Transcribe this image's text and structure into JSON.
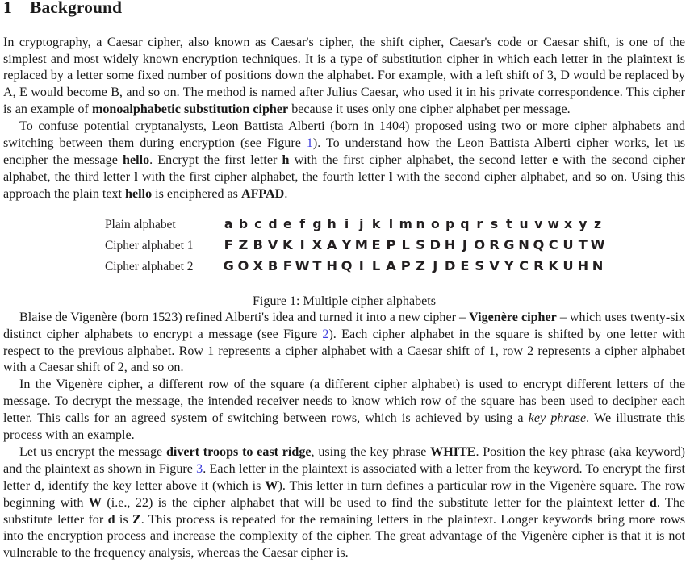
{
  "heading": {
    "number": "1",
    "title": "Background"
  },
  "paragraphs": {
    "p1_a": "In cryptography, a Caesar cipher, also known as Caesar's cipher, the shift cipher, Caesar's code or Caesar shift, is one of the simplest and most widely known encryption techniques. It is a type of substitution cipher in which each letter in the plaintext is replaced by a letter some fixed number of positions down the alphabet. For example, with a left shift of 3, D would be replaced by A, E would become B, and so on. The method is named after Julius Caesar, who used it in his private correspondence. This cipher is an example of ",
    "p1_bold": "monoalphabetic substitution cipher",
    "p1_b": " because it uses only one cipher alphabet per message.",
    "p2_a": "To confuse potential cryptanalysts, Leon Battista Alberti (born in 1404) proposed using two or more cipher alphabets and switching between them during encryption (see Figure ",
    "p2_ref1": "1",
    "p2_b": "). To understand how the Leon Battista Alberti cipher works, let us encipher the message ",
    "p2_bold1": "hello",
    "p2_c": ". Encrypt the first letter ",
    "p2_bold2": "h",
    "p2_d": " with the first cipher alphabet, the second letter ",
    "p2_bold3": "e",
    "p2_e": " with the second cipher alphabet, the third letter ",
    "p2_bold4": "l",
    "p2_f": " with the first cipher alphabet, the fourth letter ",
    "p2_bold5": "l",
    "p2_g": " with the second cipher alphabet, and so on. Using this approach the plain text ",
    "p2_bold6": "hello",
    "p2_h": " is enciphered as ",
    "p2_bold7": "AFPAD",
    "p2_i": ".",
    "p3_a": "Blaise de Vigenère (born 1523) refined Alberti's idea and turned it into a new cipher – ",
    "p3_bold1": "Vigenère cipher",
    "p3_b": " – which uses twenty-six distinct cipher alphabets to encrypt a message (see Figure ",
    "p3_ref2": "2",
    "p3_c": "). Each cipher alphabet in the square is shifted by one letter with respect to the previous alphabet. Row 1 represents a cipher alphabet with a Caesar shift of 1, row 2 represents a cipher alphabet with a Caesar shift of 2, and so on.",
    "p4_a": "In the Vigenère cipher, a different row of the square (a different cipher alphabet) is used to encrypt different letters of the message. To decrypt the message, the intended receiver needs to know which row of the square has been used to decipher each letter. This calls for an agreed system of switching between rows, which is achieved by using a ",
    "p4_italic": "key phrase",
    "p4_b": ". We illustrate this process with an example.",
    "p5_a": "Let us encrypt the message ",
    "p5_bold1": "divert troops to east ridge",
    "p5_b": ", using the key phrase ",
    "p5_bold2": "WHITE",
    "p5_c": ". Position the key phrase (aka keyword) and the plaintext as shown in Figure ",
    "p5_ref3": "3",
    "p5_d": ". Each letter in the plaintext is associated with a letter from the keyword. To encrypt the first letter ",
    "p5_bold3": "d",
    "p5_e": ", identify the key letter above it (which is ",
    "p5_bold4": "W",
    "p5_f": "). This letter in turn defines a particular row in the Vigenère square. The row beginning with ",
    "p5_bold5": "W",
    "p5_g": " (i.e., 22) is the cipher alphabet that will be used to find the substitute letter for the plaintext letter ",
    "p5_bold6": "d",
    "p5_h": ". The substitute letter for ",
    "p5_bold7": "d",
    "p5_i": " is ",
    "p5_bold8": "Z",
    "p5_j": ". This process is repeated for the remaining letters in the plaintext. Longer keywords bring more rows into the encryption process and increase the complexity of the cipher. The great advantage of the Vigenère cipher is that it is not vulnerable to the frequency analysis, whereas the Caesar cipher is."
  },
  "figure": {
    "caption": "Figure 1: Multiple cipher alphabets",
    "rows": [
      {
        "label": "Plain alphabet",
        "letters": [
          "a",
          "b",
          "c",
          "d",
          "e",
          "f",
          "g",
          "h",
          "i",
          "j",
          "k",
          "l",
          "m",
          "n",
          "o",
          "p",
          "q",
          "r",
          "s",
          "t",
          "u",
          "v",
          "w",
          "x",
          "y",
          "z"
        ]
      },
      {
        "label": "Cipher alphabet 1",
        "letters": [
          "F",
          "Z",
          "B",
          "V",
          "K",
          "I",
          "X",
          "A",
          "Y",
          "M",
          "E",
          "P",
          "L",
          "S",
          "D",
          "H",
          "J",
          "O",
          "R",
          "G",
          "N",
          "Q",
          "C",
          "U",
          "T",
          "W"
        ]
      },
      {
        "label": "Cipher alphabet 2",
        "letters": [
          "G",
          "O",
          "X",
          "B",
          "F",
          "W",
          "T",
          "H",
          "Q",
          "I",
          "L",
          "A",
          "P",
          "Z",
          "J",
          "D",
          "E",
          "S",
          "V",
          "Y",
          "C",
          "R",
          "K",
          "U",
          "H",
          "N"
        ]
      }
    ]
  },
  "colors": {
    "link": "#3c3cdc",
    "text": "#1a1a1a",
    "figure_text": "#231f20"
  }
}
